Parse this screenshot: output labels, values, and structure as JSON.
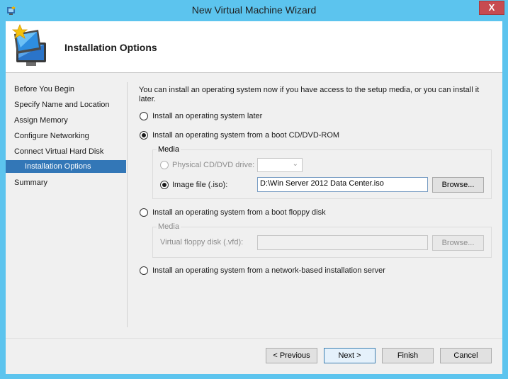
{
  "window": {
    "title": "New Virtual Machine Wizard",
    "close_glyph": "X",
    "app_icon": "hyper-v-app-icon",
    "accent_color": "#5cc4ee"
  },
  "header": {
    "title": "Installation Options",
    "icon": "new-vm-wizard-icon"
  },
  "nav": {
    "items": [
      {
        "label": "Before You Begin"
      },
      {
        "label": "Specify Name and Location"
      },
      {
        "label": "Assign Memory"
      },
      {
        "label": "Configure Networking"
      },
      {
        "label": "Connect Virtual Hard Disk"
      },
      {
        "label": "Installation Options"
      },
      {
        "label": "Summary"
      }
    ],
    "active_item": "Installation Options",
    "active_color": "#3377b7"
  },
  "content": {
    "intro": "You can install an operating system now if you have access to the setup media, or you can install it later.",
    "options": {
      "later": {
        "label": "Install an operating system later",
        "checked": false
      },
      "cd": {
        "label": "Install an operating system from a boot CD/DVD-ROM",
        "checked": true
      },
      "floppy": {
        "label": "Install an operating system from a boot floppy disk",
        "checked": false
      },
      "network": {
        "label": "Install an operating system from a network-based installation server",
        "checked": false
      }
    },
    "cd_media": {
      "group_label": "Media",
      "physical_label": "Physical CD/DVD drive:",
      "physical_selected": "",
      "image_label": "Image file (.iso):",
      "image_value": "D:\\Win Server 2012 Data Center.iso",
      "browse_label": "Browse..."
    },
    "floppy_media": {
      "group_label": "Media",
      "vfd_label": "Virtual floppy disk (.vfd):",
      "vfd_value": "",
      "browse_label": "Browse..."
    }
  },
  "footer": {
    "previous_label": "< Previous",
    "next_label": "Next >",
    "finish_label": "Finish",
    "cancel_label": "Cancel"
  }
}
